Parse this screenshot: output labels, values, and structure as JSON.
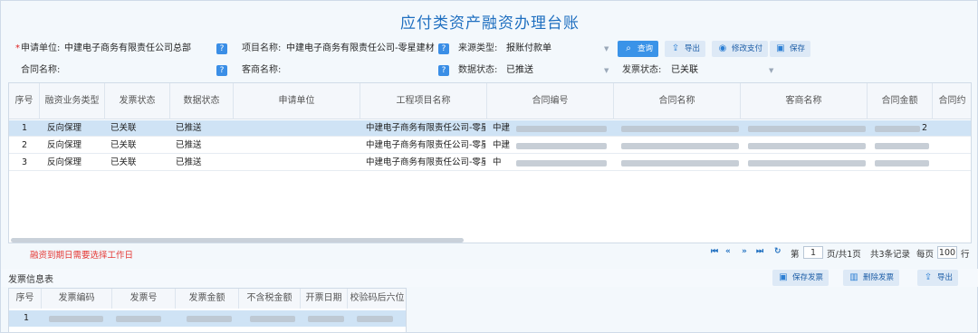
{
  "title": "应付类资产融资办理台账",
  "form": {
    "applicant_label": "申请单位:",
    "applicant_required": "*",
    "applicant_value": "中建电子商务有限责任公司总部",
    "project_label": "项目名称:",
    "project_value": "中建电子商务有限责任公司-零星建材",
    "source_label": "来源类型:",
    "source_value": "报账付款单",
    "contract_label": "合同名称:",
    "contract_value": "",
    "supplier_label": "客商名称:",
    "supplier_value": "",
    "data_status_label": "数据状态:",
    "data_status_value": "已推送",
    "invoice_status_label": "发票状态:",
    "invoice_status_value": "已关联"
  },
  "toolbar": {
    "query": "查询",
    "export": "导出",
    "modify_payment": "修改支付",
    "save": "保存"
  },
  "grid": {
    "columns": [
      "序号",
      "融资业务类型",
      "发票状态",
      "数据状态",
      "申请单位",
      "工程项目名称",
      "合同编号",
      "合同名称",
      "客商名称",
      "合同金额",
      "合同约"
    ],
    "rows": [
      {
        "no": "1",
        "type": "反向保理",
        "invoice": "已关联",
        "data": "已推送",
        "project": "中建电子商务有限责任公司-零星",
        "contract_no": "中建",
        "amount": "2"
      },
      {
        "no": "2",
        "type": "反向保理",
        "invoice": "已关联",
        "data": "已推送",
        "project": "中建电子商务有限责任公司-零星",
        "contract_no": "中建",
        "amount": ""
      },
      {
        "no": "3",
        "type": "反向保理",
        "invoice": "已关联",
        "data": "已推送",
        "project": "中建电子商务有限责任公司-零星",
        "contract_no": "中",
        "amount": ""
      }
    ]
  },
  "pager": {
    "warning": "融资到期日需要选择工作日",
    "page_label": "第",
    "page_value": "1",
    "page_suffix": "页/共1页",
    "total": "共3条记录",
    "per_page_label": "每页",
    "per_page_value": "100",
    "row_label": "行"
  },
  "invoice_section": {
    "title": "发票信息表",
    "save_invoice": "保存发票",
    "delete_invoice": "删除发票",
    "export": "导出",
    "columns": [
      "序号",
      "发票编码",
      "发票号",
      "发票金额",
      "不含税金额",
      "开票日期",
      "校验码后六位"
    ],
    "rows": [
      {
        "no": "1"
      }
    ]
  },
  "colors": {
    "accent": "#1f6fc0",
    "warning": "#e53935",
    "selected_row": "#cfe3f5"
  }
}
